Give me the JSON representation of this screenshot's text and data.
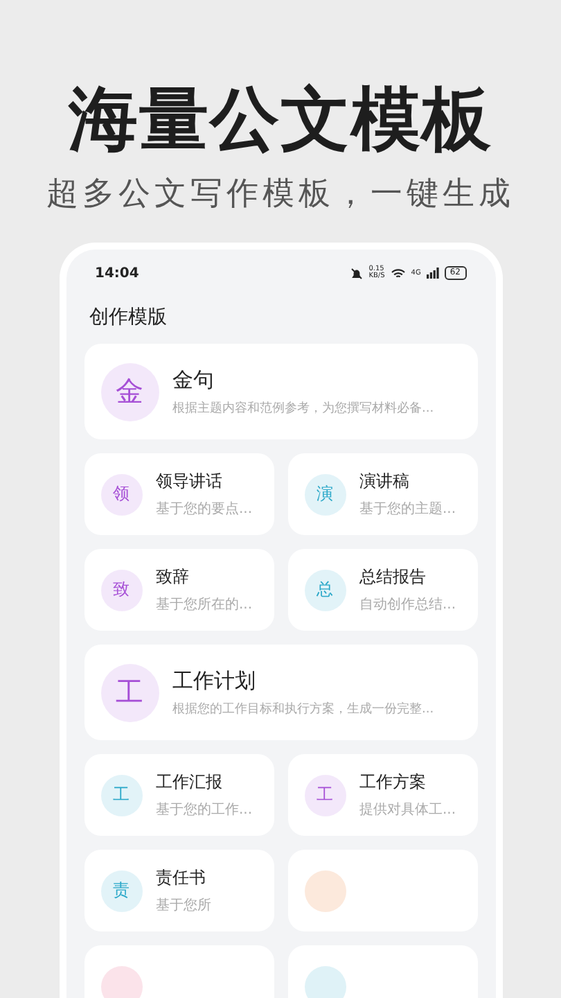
{
  "headline": "海量公文模板",
  "subtitle": "超多公文写作模板，一键生成",
  "status_bar": {
    "time": "14:04",
    "net_speed": "0.15",
    "net_unit": "KB/S",
    "network": "4G",
    "battery": "62"
  },
  "section_title": "创作模版",
  "rows": [
    {
      "kind": "wide",
      "cards": [
        {
          "icon_char": "金",
          "title": "金句",
          "description": "根据主题内容和范例参考，为您撰写材料必备...",
          "color": "#a64fd6"
        }
      ]
    },
    {
      "kind": "pair",
      "cards": [
        {
          "icon_char": "领",
          "title": "领导讲话",
          "description": "基于您的要点...",
          "color": "#a64fd6"
        },
        {
          "icon_char": "演",
          "title": "演讲稿",
          "description": "基于您的主题...",
          "color": "#29a7c8"
        }
      ]
    },
    {
      "kind": "pair",
      "cards": [
        {
          "icon_char": "致",
          "title": "致辞",
          "description": "基于您所在的...",
          "color": "#a64fd6"
        },
        {
          "icon_char": "总",
          "title": "总结报告",
          "description": "自动创作总结...",
          "color": "#29a7c8"
        }
      ]
    },
    {
      "kind": "wide",
      "cards": [
        {
          "icon_char": "工",
          "title": "工作计划",
          "description": "根据您的工作目标和执行方案，生成一份完整...",
          "color": "#a64fd6"
        }
      ]
    },
    {
      "kind": "pair",
      "cards": [
        {
          "icon_char": "工",
          "title": "工作汇报",
          "description": "基于您的工作...",
          "color": "#29a7c8"
        },
        {
          "icon_char": "工",
          "title": "工作方案",
          "description": "提供对具体工...",
          "color": "#a64fd6"
        }
      ]
    },
    {
      "kind": "pair",
      "cards": [
        {
          "icon_char": "责",
          "title": "责任书",
          "description": "基于您所",
          "color": "#29a7c8"
        },
        {
          "color": "#fce9dc"
        }
      ]
    },
    {
      "kind": "pair",
      "cards": [
        {
          "color": "#fbe3ea"
        },
        {
          "color": "#dff2f7"
        }
      ]
    }
  ]
}
